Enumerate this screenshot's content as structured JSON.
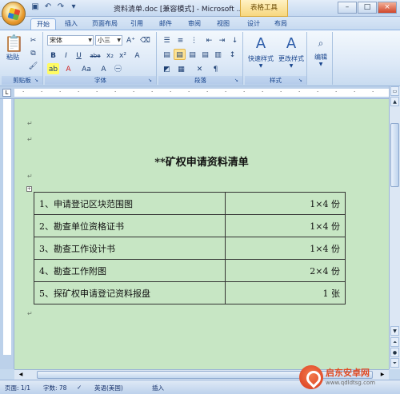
{
  "window": {
    "title": "资料清单.doc [兼容模式] - Microsoft ...",
    "context_tab": "表格工具",
    "controls": [
      "–",
      "□",
      "×"
    ]
  },
  "tabs": [
    {
      "label": "开始",
      "active": true
    },
    {
      "label": "插入"
    },
    {
      "label": "页面布局"
    },
    {
      "label": "引用"
    },
    {
      "label": "邮件"
    },
    {
      "label": "审阅"
    },
    {
      "label": "视图"
    },
    {
      "label": "设计"
    },
    {
      "label": "布局"
    }
  ],
  "ribbon": {
    "clipboard": {
      "label": "剪贴板",
      "paste": "粘贴"
    },
    "font": {
      "label": "字体",
      "name": "宋体",
      "size": "小三",
      "buttons": [
        "B",
        "I",
        "U",
        "abe",
        "x₂",
        "x²",
        "Aa"
      ]
    },
    "paragraph": {
      "label": "段落"
    },
    "styles": {
      "label": "样式",
      "quick": "快速样式",
      "change": "更改样式"
    },
    "editing": {
      "label": "编辑"
    }
  },
  "document": {
    "title": "**矿权申请资料清单",
    "paragraph_mark": "↵",
    "rows": [
      {
        "item": "1、申请登记区块范围图",
        "qty": "1×4 份"
      },
      {
        "item": "2、勘查单位资格证书",
        "qty": "1×4 份"
      },
      {
        "item": "3、勘查工作设计书",
        "qty": "1×4 份"
      },
      {
        "item": "4、勘查工作附图",
        "qty": "2×4 份"
      },
      {
        "item": "5、探矿权申请登记资料报盘",
        "qty": "1 张"
      }
    ]
  },
  "status": {
    "page": "页面: 1/1",
    "words": "字数: 78",
    "language": "英语(美国)",
    "mode": "插入"
  },
  "watermark": {
    "name": "启东安卓网",
    "url": "www.qdldtsg.com"
  }
}
